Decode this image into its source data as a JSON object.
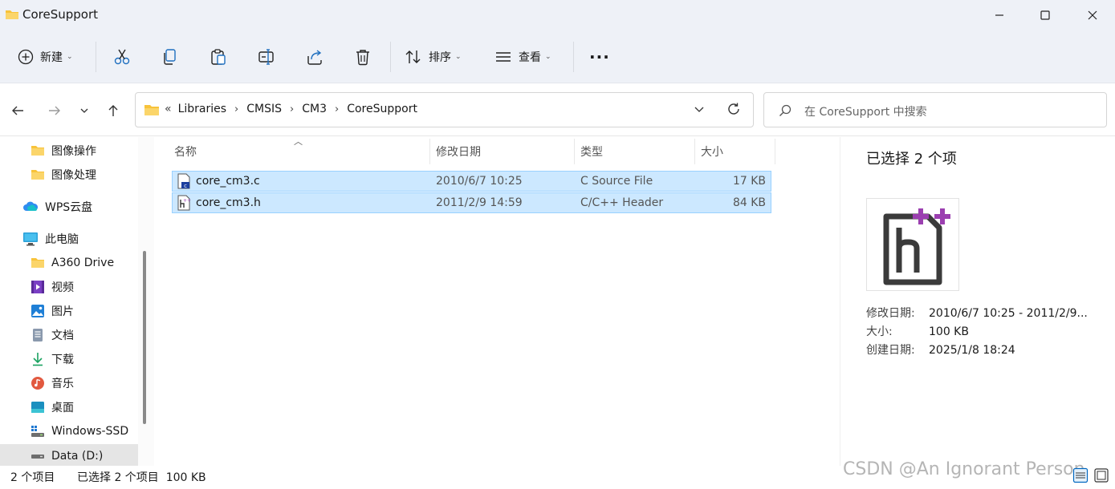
{
  "window": {
    "title": "CoreSupport",
    "controls": [
      "minimize-icon",
      "maximize-icon",
      "close-icon"
    ]
  },
  "toolbar": {
    "new_label": "新建",
    "sort_label": "排序",
    "view_label": "查看",
    "more_label": "···",
    "icons": [
      "cut-icon",
      "copy-icon",
      "paste-icon",
      "rename-icon",
      "share-icon",
      "delete-icon"
    ]
  },
  "address": {
    "overflow": "«",
    "crumbs": [
      "Libraries",
      "CMSIS",
      "CM3",
      "CoreSupport"
    ],
    "search_placeholder": "在 CoreSupport 中搜索"
  },
  "nav": {
    "items": [
      {
        "label": "图像操作",
        "icon": "folder-icon"
      },
      {
        "label": "图像处理",
        "icon": "folder-icon"
      },
      {
        "label": "WPS云盘",
        "icon": "cloud-icon"
      },
      {
        "label": "此电脑",
        "icon": "computer-icon"
      },
      {
        "label": "A360 Drive",
        "icon": "folder-icon"
      },
      {
        "label": "视频",
        "icon": "video-icon"
      },
      {
        "label": "图片",
        "icon": "picture-icon"
      },
      {
        "label": "文档",
        "icon": "document-icon"
      },
      {
        "label": "下载",
        "icon": "download-icon"
      },
      {
        "label": "音乐",
        "icon": "music-icon"
      },
      {
        "label": "桌面",
        "icon": "desktop-icon"
      },
      {
        "label": "Windows-SSD",
        "icon": "drive-icon"
      },
      {
        "label": "Data (D:)",
        "icon": "drive-icon"
      }
    ]
  },
  "files": {
    "columns": [
      "名称",
      "修改日期",
      "类型",
      "大小"
    ],
    "rows": [
      {
        "name": "core_cm3.c",
        "date": "2010/6/7 10:25",
        "type": "C Source File",
        "size": "17 KB"
      },
      {
        "name": "core_cm3.h",
        "date": "2011/2/9 14:59",
        "type": "C/C++ Header",
        "size": "84 KB"
      }
    ]
  },
  "details": {
    "title": "已选择 2 个项",
    "props": [
      {
        "k": "修改日期:",
        "v": "2010/6/7 10:25 - 2011/2/9..."
      },
      {
        "k": "大小:",
        "v": "100 KB"
      },
      {
        "k": "创建日期:",
        "v": "2025/1/8 18:24"
      }
    ]
  },
  "status": {
    "count": "2 个项目",
    "selection": "已选择 2 个项目  100 KB"
  },
  "watermark": "CSDN @An Ignorant Person",
  "colors": {
    "accent": "#0067c0",
    "selection_bg": "#cce8ff",
    "selection_border": "#99d1ff",
    "folder": "#f8c33a",
    "chrome_bg": "#eef1f7"
  }
}
